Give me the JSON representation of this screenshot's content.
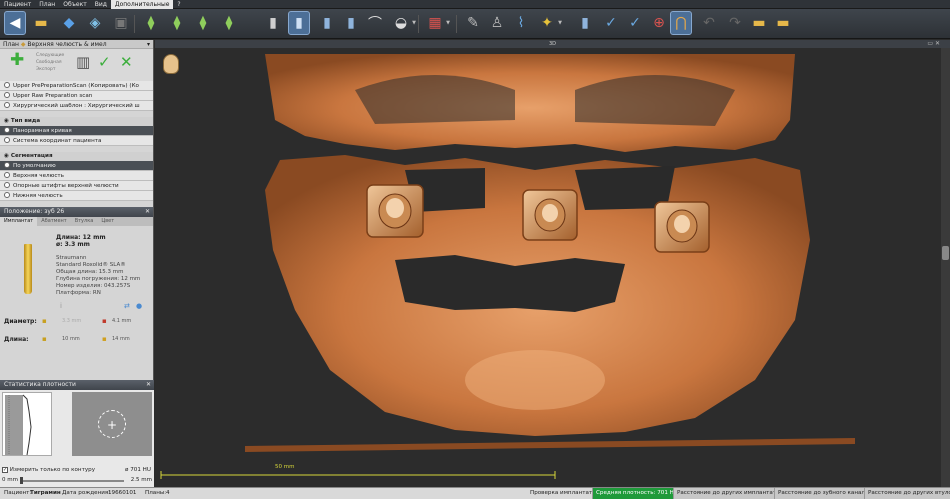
{
  "menu": {
    "items": [
      "Пациент",
      "План",
      "Объект",
      "Вид",
      "Дополнительные",
      "?"
    ],
    "active_index": 4
  },
  "toolbar": {
    "buttons": [
      {
        "icon": "back-arrow-icon"
      },
      {
        "icon": "open-folder-icon"
      },
      {
        "icon": "save-icon"
      },
      {
        "icon": "export-icon"
      },
      {
        "icon": "print-icon"
      },
      {
        "icon": "implant-add-icon"
      },
      {
        "icon": "implant-move-icon"
      },
      {
        "icon": "implant-rotate-icon"
      },
      {
        "icon": "implant-axis-icon"
      },
      {
        "icon": "implant-align-icon"
      },
      {
        "icon": "implant-selected-icon"
      },
      {
        "icon": "implant-depth-icon"
      },
      {
        "icon": "implant-sleeve-icon"
      },
      {
        "icon": "template-icon"
      },
      {
        "icon": "view-options-icon"
      },
      {
        "icon": "brush-icon"
      },
      {
        "icon": "density-icon"
      },
      {
        "icon": "measure-icon"
      },
      {
        "icon": "nerve-icon"
      },
      {
        "icon": "abutment-icon"
      },
      {
        "icon": "marker-icon"
      },
      {
        "icon": "panorama-icon"
      },
      {
        "icon": "undo-icon"
      },
      {
        "icon": "redo-icon"
      },
      {
        "icon": "folder-open-icon"
      },
      {
        "icon": "folder-save-icon"
      }
    ]
  },
  "plan_panel": {
    "title": "План",
    "plan_name": "Верхняя челюсть & имел",
    "action_labels": [
      "Следующие",
      "Свободная",
      "Экспорт"
    ],
    "objects": [
      "Upper PrePreparationScan (Копировать) (Ко",
      "Upper Raw Preparation scan",
      "Хирургический шаблон : Хирургический ш"
    ],
    "view_type_title": "Тип вида",
    "view_types": [
      "Панорамная кривая",
      "Система координат пациента"
    ],
    "segmentation_title": "Сегментация",
    "segmentation": [
      "По умолчанию",
      "Верхняя челюсть",
      "Опорные штифты верхней челюсти",
      "Нижняя челюсть"
    ]
  },
  "implant_panel": {
    "title": "Положение: зуб 26",
    "tabs": [
      "Имплантат",
      "Абатмент",
      "Втулка",
      "Цвет"
    ],
    "active_tab": 0,
    "length_label": "Длина: 12 mm",
    "diameter_label": "ø: 3.3 mm",
    "details": [
      "Straumann",
      "Standard Roxolid® SLA®",
      "Общая длина: 15.3 mm",
      "Глубина погружения: 12 mm",
      "Номер изделия: 043.257S",
      "Платформа: RN"
    ],
    "diameter_row_label": "Диаметр:",
    "diameter_min": "3.3 mm",
    "diameter_max": "4.1 mm",
    "length_row_label": "Длина:",
    "length_min": "10 mm",
    "length_max": "14 mm"
  },
  "density_panel": {
    "title": "Статистика плотности",
    "checkbox_label": "Измерить только по контуру",
    "checkbox_checked": true,
    "hu_value": "ø 701 HU",
    "range_min": "0 mm",
    "range_max": "2.5 mm"
  },
  "viewport": {
    "label": "3D",
    "scale_label": "50 mm"
  },
  "status_bar": {
    "patient_label": "Пациент:",
    "patient_value": "Тиграмин",
    "dob_label": "Дата рождения:",
    "dob_value": "19660101",
    "plans_label": "Планы:",
    "plans_value": "4",
    "check_label": "Проверка имплантата:",
    "chips": [
      "Средняя плотность: 701 HU",
      "Расстояние до других имплантатов",
      "Расстояние до зубного канала",
      "Расстояние до других втулок"
    ]
  }
}
